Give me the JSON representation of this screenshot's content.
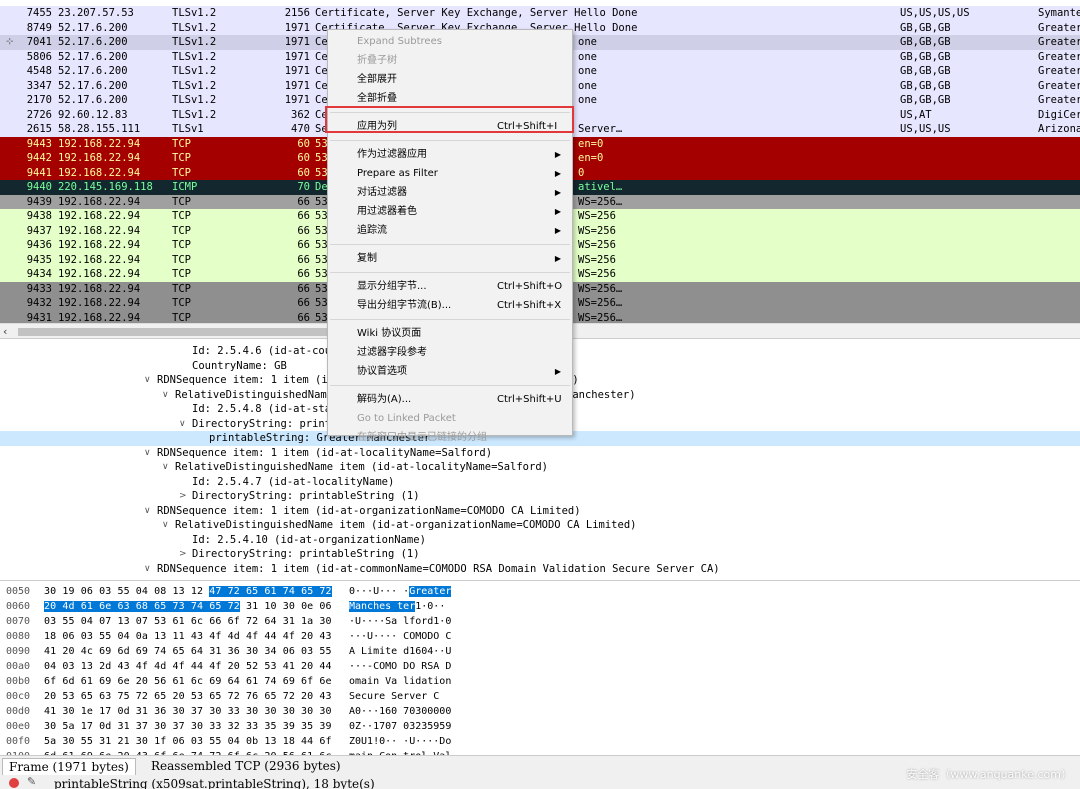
{
  "packets": [
    {
      "no": "7455",
      "src": "23.207.57.53",
      "proto": "TLSv1.2",
      "len": "2156",
      "info": "Certificate, Server Key Exchange, Server Hello Done",
      "info2": "",
      "geo": "US,US,US,US",
      "org": "Symante",
      "style": "tls"
    },
    {
      "no": "8749",
      "src": "52.17.6.200",
      "proto": "TLSv1.2",
      "len": "1971",
      "info": "Certificate, Server Key Exchange, Server Hello Done",
      "info2": "",
      "geo": "GB,GB,GB",
      "org": "Greater",
      "style": "tls"
    },
    {
      "no": "7041",
      "src": "52.17.6.200",
      "proto": "TLSv1.2",
      "len": "1971",
      "info": "Certifi",
      "info2": "one",
      "geo": "GB,GB,GB",
      "org": "Greater",
      "style": "tls-sel"
    },
    {
      "no": "5806",
      "src": "52.17.6.200",
      "proto": "TLSv1.2",
      "len": "1971",
      "info": "Certifi",
      "info2": "one",
      "geo": "GB,GB,GB",
      "org": "Greater",
      "style": "tls"
    },
    {
      "no": "4548",
      "src": "52.17.6.200",
      "proto": "TLSv1.2",
      "len": "1971",
      "info": "Certifi",
      "info2": "one",
      "geo": "GB,GB,GB",
      "org": "Greater",
      "style": "tls"
    },
    {
      "no": "3347",
      "src": "52.17.6.200",
      "proto": "TLSv1.2",
      "len": "1971",
      "info": "Certifi",
      "info2": "one",
      "geo": "GB,GB,GB",
      "org": "Greater",
      "style": "tls"
    },
    {
      "no": "2170",
      "src": "52.17.6.200",
      "proto": "TLSv1.2",
      "len": "1971",
      "info": "Certifi",
      "info2": "one",
      "geo": "GB,GB,GB",
      "org": "Greater",
      "style": "tls"
    },
    {
      "no": "2726",
      "src": "92.60.12.83",
      "proto": "TLSv1.2",
      "len": "362",
      "info": "Certifi",
      "info2": "",
      "geo": "US,AT",
      "org": "DigiCer",
      "style": "tls"
    },
    {
      "no": "2615",
      "src": "58.28.155.111",
      "proto": "TLSv1",
      "len": "470",
      "info": "Server",
      "info2": "Server…",
      "geo": "US,US,US",
      "org": "Arizona",
      "style": "tls"
    },
    {
      "no": "9443",
      "src": "192.168.22.94",
      "proto": "TCP",
      "len": "60",
      "info": "53600 →",
      "info2": "en=0",
      "geo": "",
      "org": "",
      "style": "red"
    },
    {
      "no": "9442",
      "src": "192.168.22.94",
      "proto": "TCP",
      "len": "60",
      "info": "53537 →",
      "info2": "en=0",
      "geo": "",
      "org": "",
      "style": "red"
    },
    {
      "no": "9441",
      "src": "192.168.22.94",
      "proto": "TCP",
      "len": "60",
      "info": "53536 →",
      "info2": "0",
      "geo": "",
      "org": "",
      "style": "red"
    },
    {
      "no": "9440",
      "src": "220.145.169.118",
      "proto": "ICMP",
      "len": "70",
      "info": "Destina",
      "info2": "ativel…",
      "geo": "",
      "org": "",
      "style": "icmp"
    },
    {
      "no": "9439",
      "src": "192.168.22.94",
      "proto": "TCP",
      "len": "66",
      "info": "53689 →",
      "info2": "WS=256…",
      "geo": "",
      "org": "",
      "style": "gray"
    },
    {
      "no": "9438",
      "src": "192.168.22.94",
      "proto": "TCP",
      "len": "66",
      "info": "53688 →",
      "info2": "WS=256",
      "geo": "",
      "org": "",
      "style": "green"
    },
    {
      "no": "9437",
      "src": "192.168.22.94",
      "proto": "TCP",
      "len": "66",
      "info": "53687 →",
      "info2": "WS=256",
      "geo": "",
      "org": "",
      "style": "green"
    },
    {
      "no": "9436",
      "src": "192.168.22.94",
      "proto": "TCP",
      "len": "66",
      "info": "53686 →",
      "info2": "WS=256",
      "geo": "",
      "org": "",
      "style": "green"
    },
    {
      "no": "9435",
      "src": "192.168.22.94",
      "proto": "TCP",
      "len": "66",
      "info": "53685 →",
      "info2": "WS=256",
      "geo": "",
      "org": "",
      "style": "green"
    },
    {
      "no": "9434",
      "src": "192.168.22.94",
      "proto": "TCP",
      "len": "66",
      "info": "53684 →",
      "info2": "WS=256",
      "geo": "",
      "org": "",
      "style": "green"
    },
    {
      "no": "9433",
      "src": "192.168.22.94",
      "proto": "TCP",
      "len": "66",
      "info": "53683 →",
      "info2": "WS=256…",
      "geo": "",
      "org": "",
      "style": "dkgray"
    },
    {
      "no": "9432",
      "src": "192.168.22.94",
      "proto": "TCP",
      "len": "66",
      "info": "53682 →",
      "info2": "WS=256…",
      "geo": "",
      "org": "",
      "style": "dkgray"
    },
    {
      "no": "9431",
      "src": "192.168.22.94",
      "proto": "TCP",
      "len": "66",
      "info": "53681 →",
      "info2": "WS=256…",
      "geo": "",
      "org": "",
      "style": "dkgray"
    }
  ],
  "details": [
    {
      "indent": 192,
      "tw": "",
      "text": "Id: 2.5.4.6 (id-at-cour",
      "sel": false
    },
    {
      "indent": 192,
      "tw": "",
      "text": "CountryName: GB",
      "sel": false
    },
    {
      "indent": 157,
      "tw": "∨",
      "text": "RDNSequence item: 1 item (id",
      "right": "r)",
      "rightX": 566,
      "sel": false
    },
    {
      "indent": 175,
      "tw": "∨",
      "text": "RelativeDistinguishedName",
      "right": "Manchester)",
      "rightX": 566,
      "sel": false
    },
    {
      "indent": 192,
      "tw": "",
      "text": "Id: 2.5.4.8 (id-at-stat",
      "sel": false
    },
    {
      "indent": 192,
      "tw": "∨",
      "text": "DirectoryString: printa",
      "sel": false
    },
    {
      "indent": 209,
      "tw": "",
      "text": "printableString: Greater Manchester",
      "sel": true
    },
    {
      "indent": 157,
      "tw": "∨",
      "text": "RDNSequence item: 1 item (id-at-localityName=Salford)",
      "sel": false
    },
    {
      "indent": 175,
      "tw": "∨",
      "text": "RelativeDistinguishedName item (id-at-localityName=Salford)",
      "sel": false
    },
    {
      "indent": 192,
      "tw": "",
      "text": "Id: 2.5.4.7 (id-at-localityName)",
      "sel": false
    },
    {
      "indent": 192,
      "tw": ">",
      "text": "DirectoryString: printableString (1)",
      "sel": false
    },
    {
      "indent": 157,
      "tw": "∨",
      "text": "RDNSequence item: 1 item (id-at-organizationName=COMODO CA Limited)",
      "sel": false
    },
    {
      "indent": 175,
      "tw": "∨",
      "text": "RelativeDistinguishedName item (id-at-organizationName=COMODO CA Limited)",
      "sel": false
    },
    {
      "indent": 192,
      "tw": "",
      "text": "Id: 2.5.4.10 (id-at-organizationName)",
      "sel": false
    },
    {
      "indent": 192,
      "tw": ">",
      "text": "DirectoryString: printableString (1)",
      "sel": false
    },
    {
      "indent": 157,
      "tw": "∨",
      "text": "RDNSequence item: 1 item (id-at-commonName=COMODO RSA Domain Validation Secure Server CA)",
      "sel": false
    }
  ],
  "hex": [
    {
      "off": "0050",
      "bytes": "30 19 06 03 55 04 08 13  12 ",
      "bytesHl": "47 72 65 61 74 65 72",
      "ascii": "0···U···  ·",
      "asciiHl": "Greater"
    },
    {
      "off": "0060",
      "bytes": "",
      "bytesHl": "20 4d 61 6e 63 68 65 73  74 65 72",
      "bytesRest": " 31 10 30 0e 06",
      "ascii": "",
      "asciiHl": " Manches ter",
      "asciiRest": "1·0··"
    },
    {
      "off": "0070",
      "bytes": "03 55 04 07 13 07 53 61  6c 66 6f 72 64 31 1a 30",
      "ascii": "·U····Sa lford1·0"
    },
    {
      "off": "0080",
      "bytes": "18 06 03 55 04 0a 13 11  43 4f 4d 4f 44 4f 20 43",
      "ascii": "···U···· COMODO C"
    },
    {
      "off": "0090",
      "bytes": "41 20 4c 69 6d 69 74 65  64 31 36 30 34 06 03 55",
      "ascii": "A Limite d1604··U"
    },
    {
      "off": "00a0",
      "bytes": "04 03 13 2d 43 4f 4d 4f  44 4f 20 52 53 41 20 44",
      "ascii": "···-COMO DO RSA D"
    },
    {
      "off": "00b0",
      "bytes": "6f 6d 61 69 6e 20 56 61  6c 69 64 61 74 69 6f 6e",
      "ascii": "omain Va lidation"
    },
    {
      "off": "00c0",
      "bytes": "20 53 65 63 75 72 65 20  53 65 72 76 65 72 20 43",
      "ascii": " Secure  Server C"
    },
    {
      "off": "00d0",
      "bytes": "41 30 1e 17 0d 31 36 30  37 30 33 30 30 30 30 30",
      "ascii": "A0···160 70300000"
    },
    {
      "off": "00e0",
      "bytes": "30 5a 17 0d 31 37 30 37  30 33 32 33 35 39 35 39",
      "ascii": "0Z··1707 03235959"
    },
    {
      "off": "00f0",
      "bytes": "5a 30 55 31 21 30 1f 06  03 55 04 0b 13 18 44 6f",
      "ascii": "Z0U1!0·· ·U····Do"
    },
    {
      "off": "0100",
      "bytes": "6d 61 69 6e 20 43 6f 6e  74 72 6f 6c 20 56 61 6c",
      "ascii": "main Con trol Val"
    },
    {
      "off": "0110",
      "bytes": "69 64 61 74 65 64 31 15  30 13 06 03 55 04 0b 13",
      "ascii": "idated1· 0···U···"
    }
  ],
  "tabs": [
    {
      "label": "Frame (1971 bytes)",
      "active": true
    },
    {
      "label": "Reassembled TCP (2936 bytes)",
      "active": false
    }
  ],
  "status": {
    "text": "printableString (x509sat.printableString), 18 byte(s)"
  },
  "watermark": "安全客（www.anquanke.com）",
  "menu": [
    {
      "type": "item",
      "label": "Expand Subtrees",
      "sc": "",
      "sub": false,
      "dis": true
    },
    {
      "type": "item",
      "label": "折叠子树",
      "sc": "",
      "sub": false,
      "dis": true
    },
    {
      "type": "item",
      "label": "全部展开",
      "sc": "",
      "sub": false,
      "dis": false
    },
    {
      "type": "item",
      "label": "全部折叠",
      "sc": "",
      "sub": false,
      "dis": false
    },
    {
      "type": "sep"
    },
    {
      "type": "item",
      "label": "应用为列",
      "sc": "Ctrl+Shift+I",
      "sub": false,
      "dis": false
    },
    {
      "type": "sep"
    },
    {
      "type": "item",
      "label": "作为过滤器应用",
      "sc": "",
      "sub": true,
      "dis": false
    },
    {
      "type": "item",
      "label": "Prepare as Filter",
      "sc": "",
      "sub": true,
      "dis": false
    },
    {
      "type": "item",
      "label": "对话过滤器",
      "sc": "",
      "sub": true,
      "dis": false
    },
    {
      "type": "item",
      "label": "用过滤器着色",
      "sc": "",
      "sub": true,
      "dis": false
    },
    {
      "type": "item",
      "label": "追踪流",
      "sc": "",
      "sub": true,
      "dis": false
    },
    {
      "type": "sep"
    },
    {
      "type": "item",
      "label": "复制",
      "sc": "",
      "sub": true,
      "dis": false
    },
    {
      "type": "sep"
    },
    {
      "type": "item",
      "label": "显示分组字节...",
      "sc": "Ctrl+Shift+O",
      "sub": false,
      "dis": false
    },
    {
      "type": "item",
      "label": "导出分组字节流(B)...",
      "sc": "Ctrl+Shift+X",
      "sub": false,
      "dis": false
    },
    {
      "type": "sep"
    },
    {
      "type": "item",
      "label": "Wiki 协议页面",
      "sc": "",
      "sub": false,
      "dis": false
    },
    {
      "type": "item",
      "label": "过滤器字段参考",
      "sc": "",
      "sub": false,
      "dis": false
    },
    {
      "type": "item",
      "label": "协议首选项",
      "sc": "",
      "sub": true,
      "dis": false
    },
    {
      "type": "sep"
    },
    {
      "type": "item",
      "label": "解码为(A)...",
      "sc": "Ctrl+Shift+U",
      "sub": false,
      "dis": false
    },
    {
      "type": "item",
      "label": "Go to Linked Packet",
      "sc": "",
      "sub": false,
      "dis": true
    },
    {
      "type": "item",
      "label": "在新窗口中显示已链接的分组",
      "sc": "",
      "sub": false,
      "dis": true
    }
  ]
}
